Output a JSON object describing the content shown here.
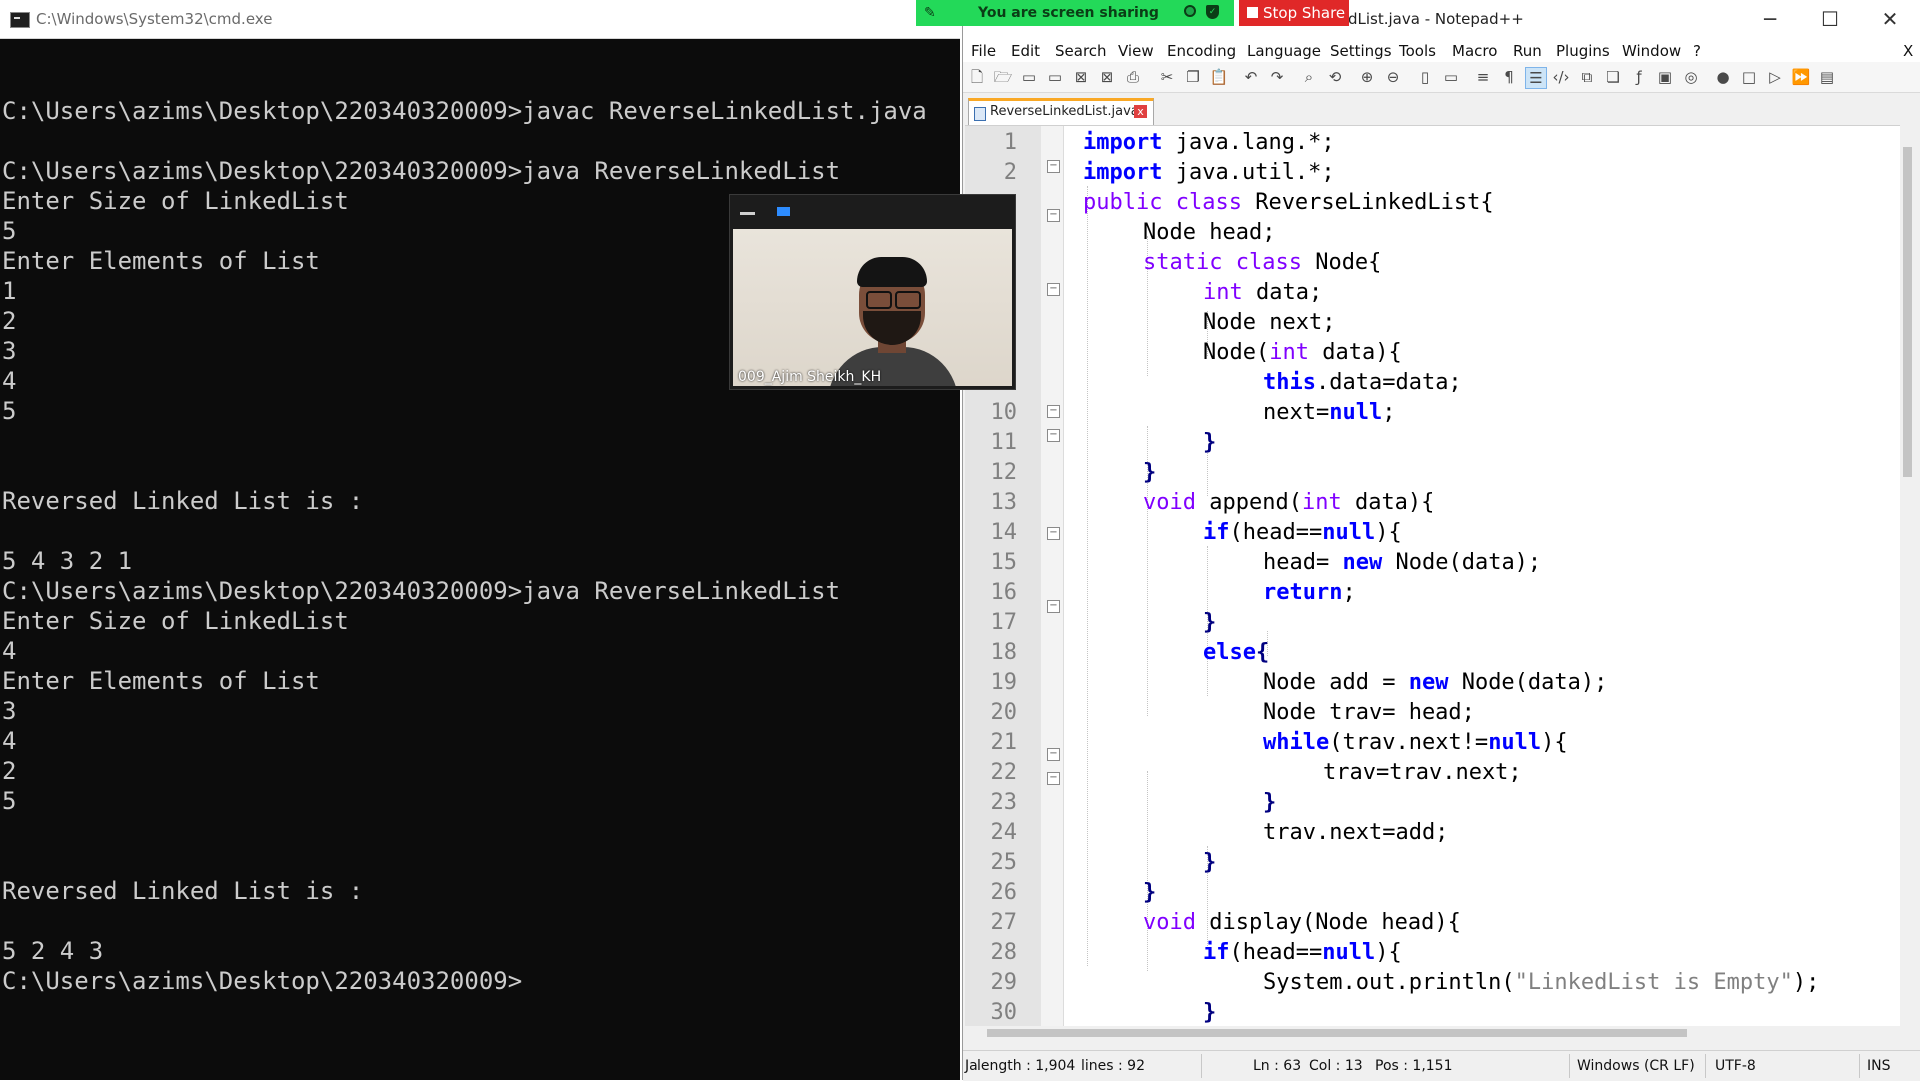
{
  "cmd": {
    "title": "C:\\Windows\\System32\\cmd.exe",
    "lines": [
      "",
      "C:\\Users\\azims\\Desktop\\220340320009>javac ReverseLinkedList.java",
      "",
      "C:\\Users\\azims\\Desktop\\220340320009>java ReverseLinkedList",
      "Enter Size of LinkedList",
      "5",
      "Enter Elements of List",
      "1",
      "2",
      "3",
      "4",
      "5",
      "",
      "",
      "Reversed Linked List is :",
      "",
      "5 4 3 2 1",
      "C:\\Users\\azims\\Desktop\\220340320009>java ReverseLinkedList",
      "Enter Size of LinkedList",
      "4",
      "Enter Elements of List",
      "3",
      "4",
      "2",
      "5",
      "",
      "",
      "Reversed Linked List is :",
      "",
      "5 2 4 3",
      "C:\\Users\\azims\\Desktop\\220340320009>"
    ]
  },
  "notepad": {
    "title": "dList.java - Notepad++",
    "menu": [
      "File",
      "Edit",
      "Search",
      "View",
      "Encoding",
      "Language",
      "Settings",
      "Tools",
      "Macro",
      "Run",
      "Plugins",
      "Window",
      "?"
    ],
    "menu_close": "X",
    "tab_label": "ReverseLinkedList.java",
    "tab_close": "x",
    "window_controls": {
      "minimize": "─",
      "maximize": "☐",
      "close": "✕"
    },
    "line_numbers": [
      "1",
      "2",
      "",
      "",
      "",
      "",
      "",
      "",
      "",
      "10",
      "11",
      "12",
      "13",
      "14",
      "15",
      "16",
      "17",
      "18",
      "19",
      "20",
      "21",
      "22",
      "23",
      "24",
      "25",
      "26",
      "27",
      "28",
      "29",
      "30"
    ],
    "status": {
      "length": "length : 1,904",
      "lines": "lines : 92",
      "ln": "Ln : 63",
      "col": "Col : 13",
      "pos": "Pos : 1,151",
      "eol": "Windows (CR LF)",
      "encoding": "UTF-8",
      "mode": "INS",
      "prefix": "Ja"
    }
  },
  "code": {
    "l1_a": "import",
    "l1_b": " java.lang.*;",
    "l2_a": "import",
    "l2_b": " java.util.*;",
    "l3_a": "public class",
    "l3_b": " ReverseLinkedList{",
    "l4": "Node head;",
    "l5_a": "static class",
    "l5_b": " Node{",
    "l6_a": "int",
    "l6_b": " data;",
    "l7": "Node next;",
    "l8_a": "Node(",
    "l8_b": "int",
    "l8_c": " data){",
    "l9_a": "this",
    "l9_b": ".data=data;",
    "l10_a": "next=",
    "l10_b": "null",
    "l10_c": ";",
    "l11": "}",
    "l12": "}",
    "l13_a": "void",
    "l13_b": " append(",
    "l13_c": "int",
    "l13_d": " data){",
    "l14_a": "if",
    "l14_b": "(head==",
    "l14_c": "null",
    "l14_d": "){",
    "l15_a": "head= ",
    "l15_b": "new",
    "l15_c": " Node(data);",
    "l16_a": "return",
    "l16_b": ";",
    "l17": "}",
    "l18_a": "else",
    "l18_b": "{",
    "l19_a": "Node add = ",
    "l19_b": "new",
    "l19_c": " Node(data);",
    "l20": "Node trav= head;",
    "l21_a": "while",
    "l21_b": "(trav.next!=",
    "l21_c": "null",
    "l21_d": "){",
    "l22": "trav=trav.next;",
    "l23": "}",
    "l24": "trav.next=add;",
    "l25": "}",
    "l26": "}",
    "l27_a": "void",
    "l27_b": " display(Node head){",
    "l28_a": "if",
    "l28_b": "(head==",
    "l28_c": "null",
    "l28_d": "){",
    "l29_a": "System.out.println(",
    "l29_b": "\"LinkedList is Empty\"",
    "l29_c": ");",
    "l30": "}"
  },
  "zoom": {
    "sharing_text": "You are screen sharing",
    "stop_label": "Stop Share",
    "participant_name": "009_Ajim Sheikh_KH"
  },
  "colors": {
    "keyword": "#0000ff",
    "type": "#8000ff",
    "string": "#808080",
    "share_green": "#23d959",
    "stop_red": "#e02828"
  }
}
